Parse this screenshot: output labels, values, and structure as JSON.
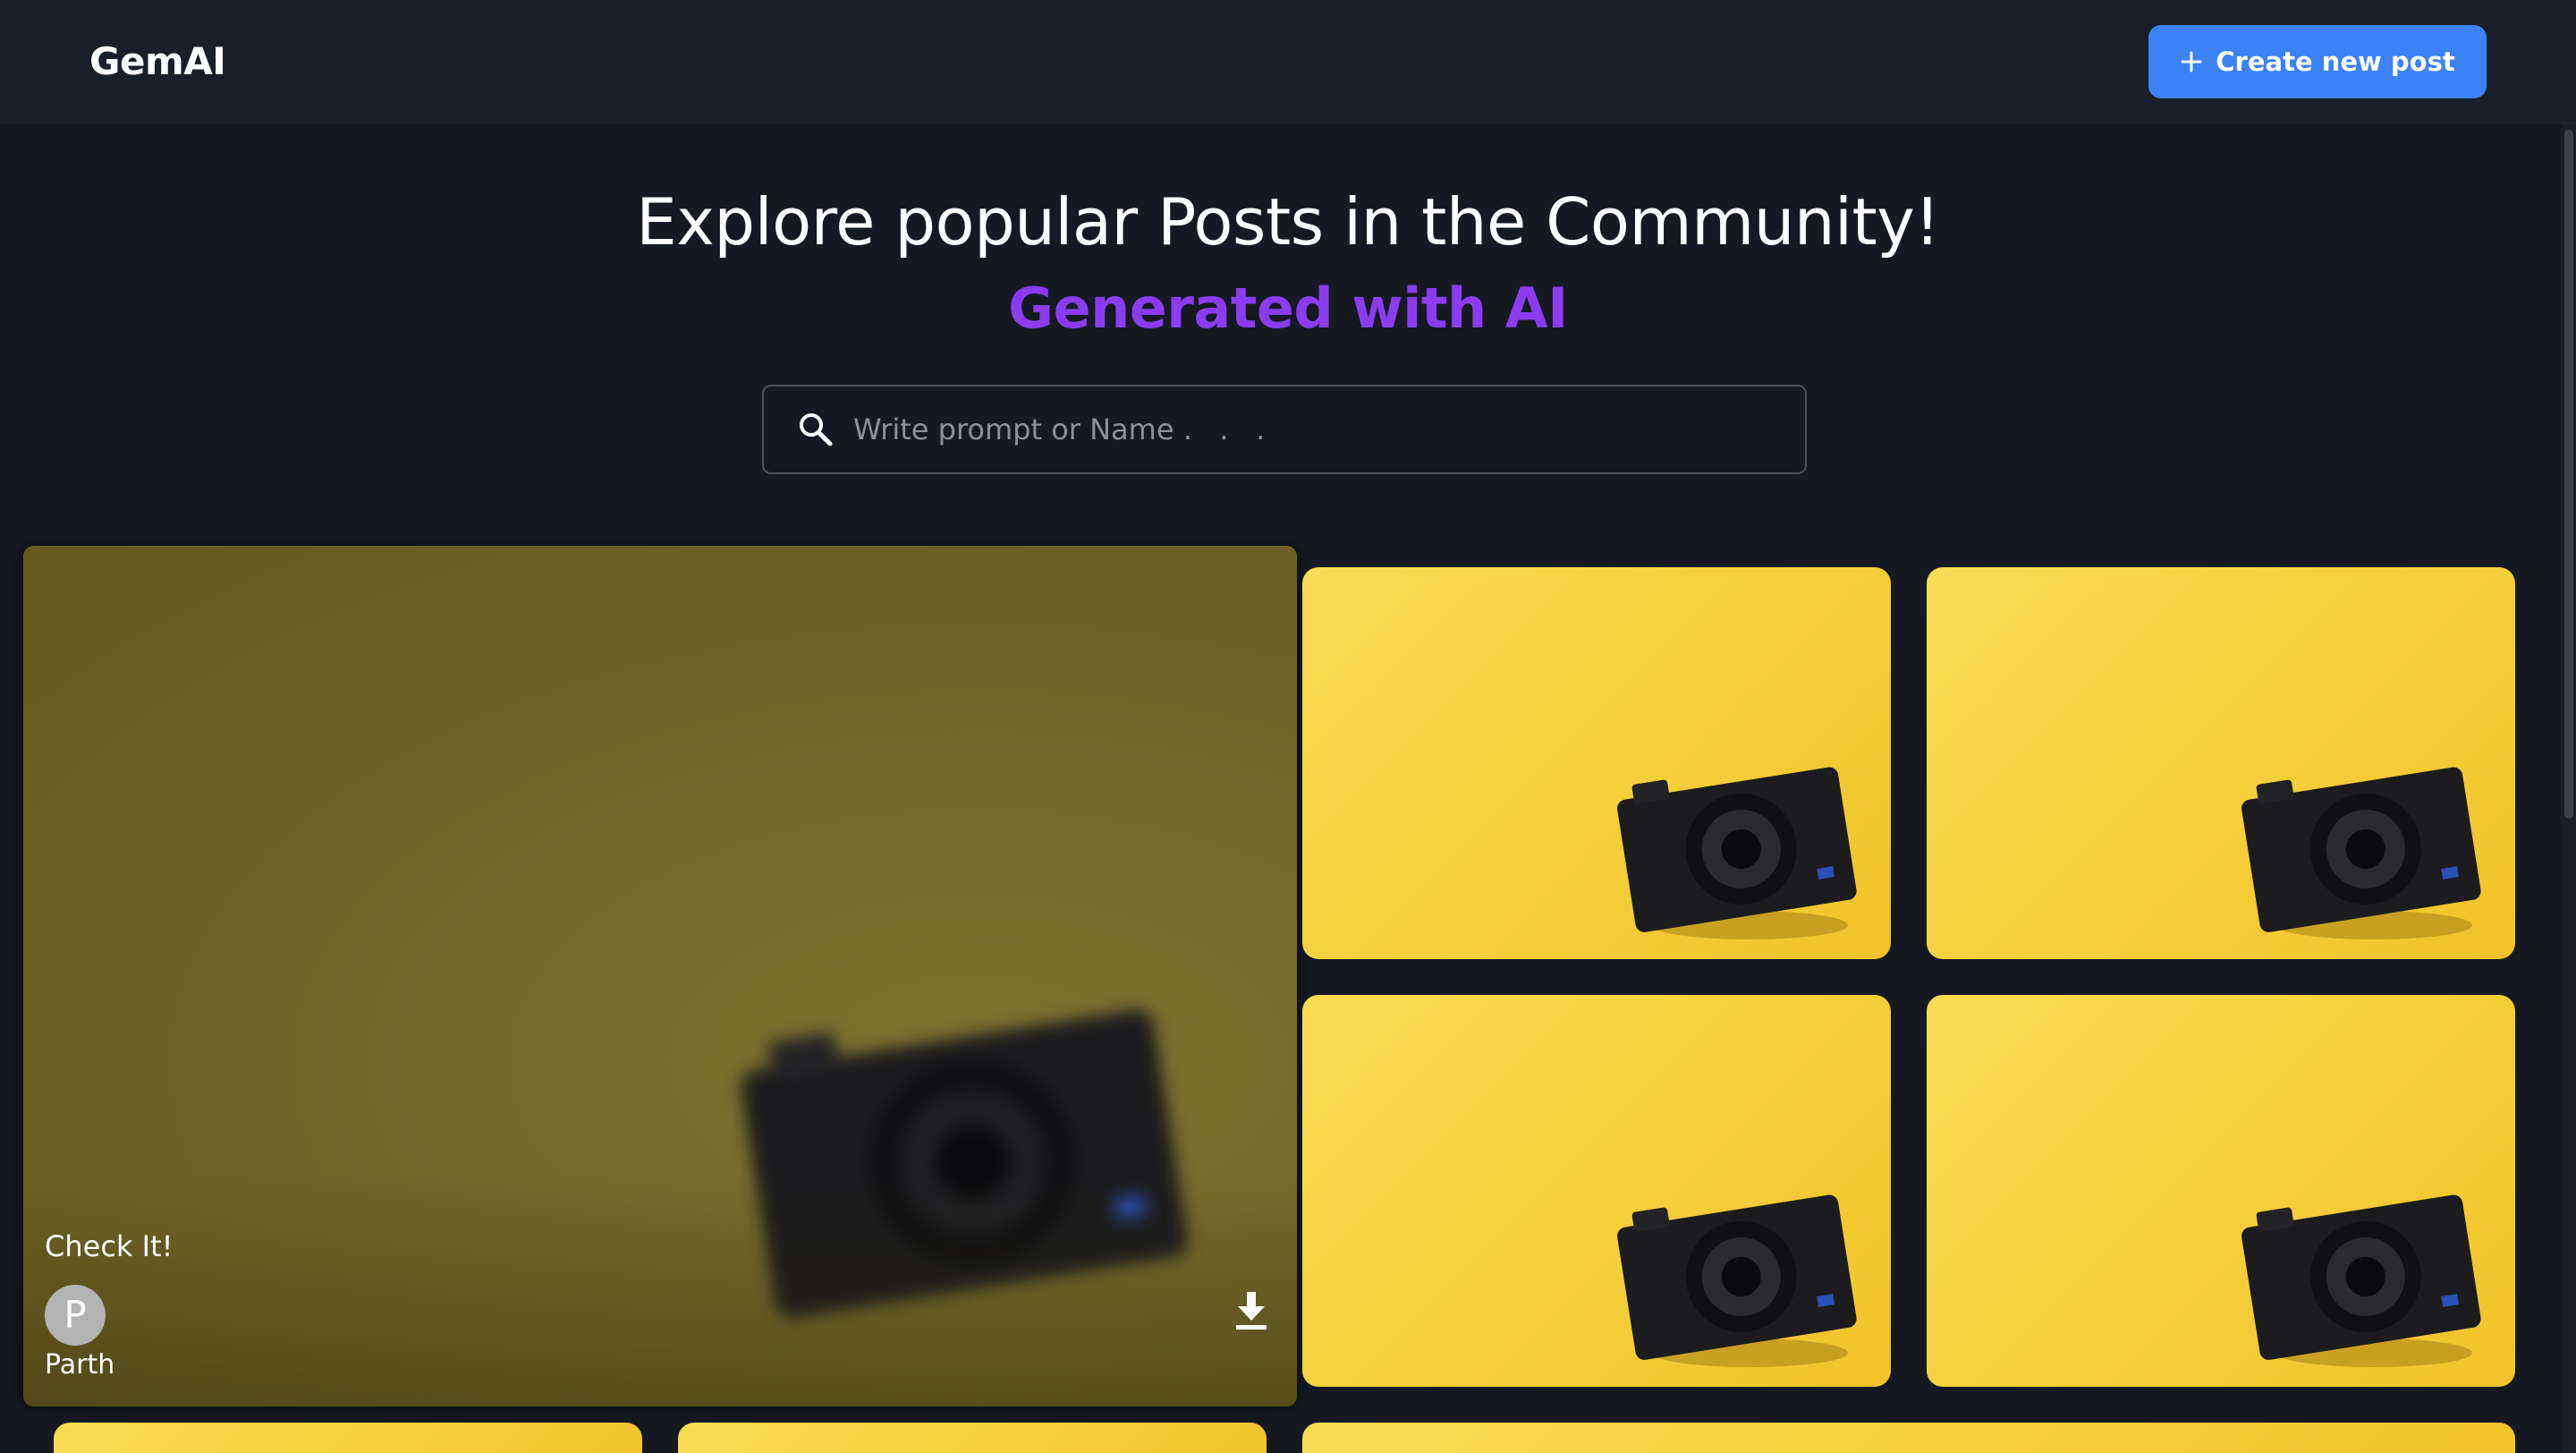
{
  "app": {
    "logo": "GemAI"
  },
  "header": {
    "create_label": "Create new post"
  },
  "hero": {
    "title": "Explore popular Posts in the Community!",
    "subtitle": "Generated with AI"
  },
  "search": {
    "placeholder": "Write prompt or Name .   .   .",
    "value": ""
  },
  "featured_post": {
    "caption": "Check It!",
    "author_initial": "P",
    "author_name": "Parth"
  },
  "colors": {
    "accent": "#3a82f6",
    "subtitle": "#8b3cf0",
    "background": "#161922",
    "card_yellow": "#f5cf3a"
  },
  "icons": {
    "create": "plus-icon",
    "search": "search-icon",
    "download": "download-icon"
  }
}
